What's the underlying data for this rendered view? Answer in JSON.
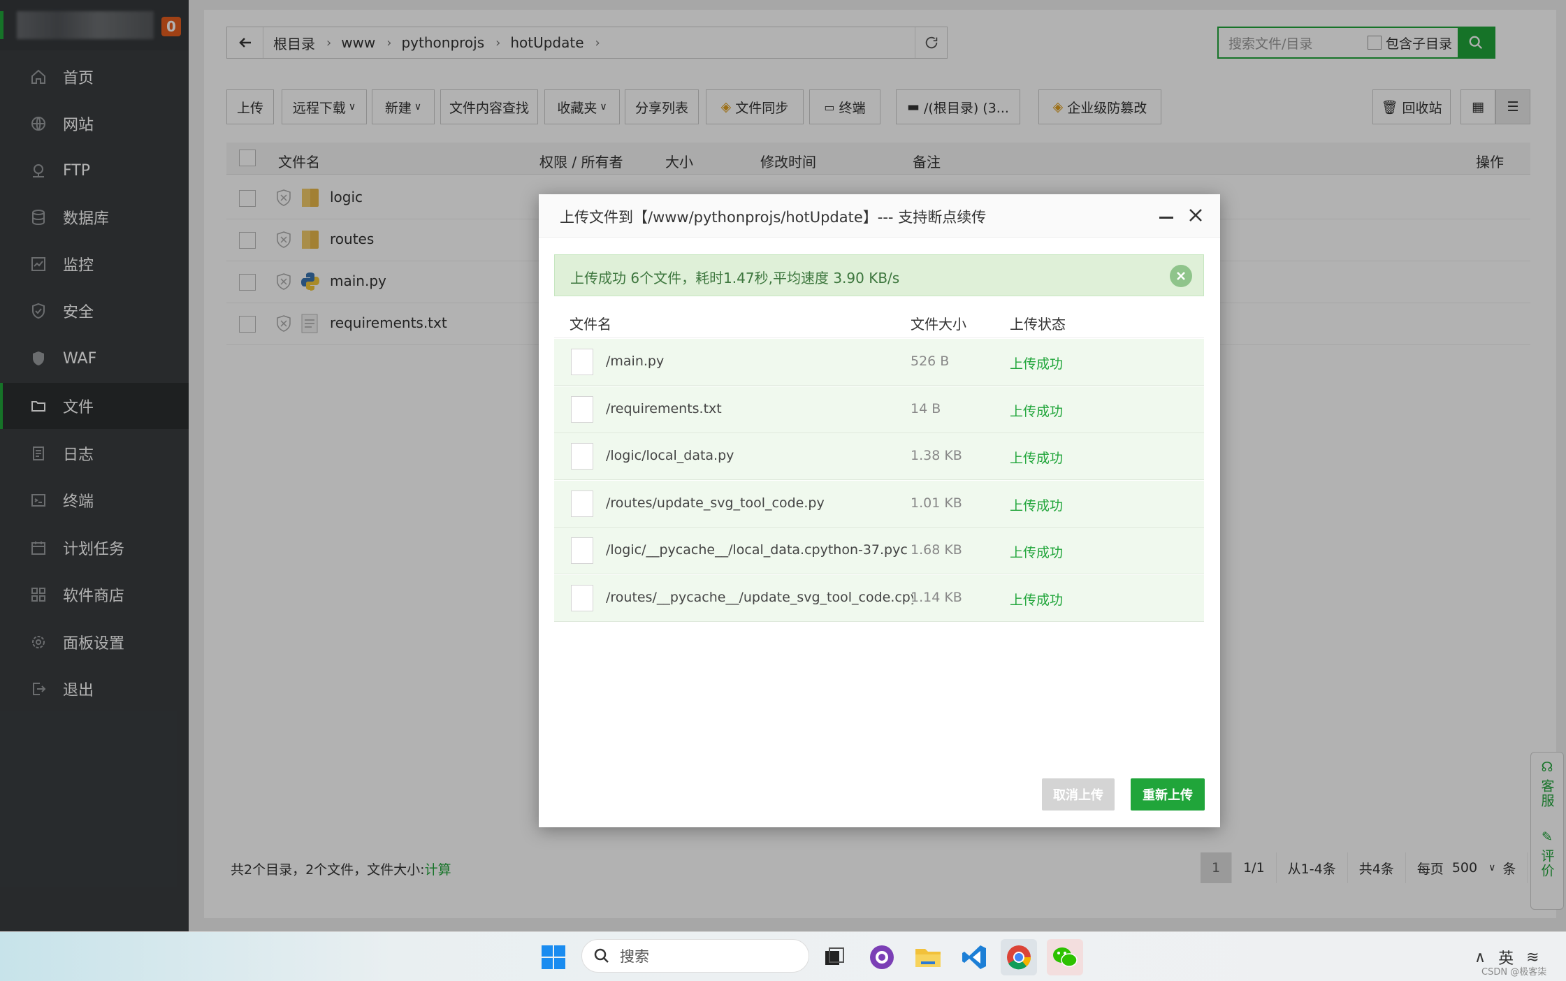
{
  "sidebar": {
    "badge": "0",
    "items": [
      {
        "label": "首页",
        "icon": "home-icon"
      },
      {
        "label": "网站",
        "icon": "globe-icon"
      },
      {
        "label": "FTP",
        "icon": "ftp-icon"
      },
      {
        "label": "数据库",
        "icon": "database-icon"
      },
      {
        "label": "监控",
        "icon": "monitor-icon"
      },
      {
        "label": "安全",
        "icon": "shield-icon"
      },
      {
        "label": "WAF",
        "icon": "waf-shield-icon"
      },
      {
        "label": "文件",
        "icon": "folder-icon",
        "active": true
      },
      {
        "label": "日志",
        "icon": "log-icon"
      },
      {
        "label": "终端",
        "icon": "terminal-icon"
      },
      {
        "label": "计划任务",
        "icon": "calendar-icon"
      },
      {
        "label": "软件商店",
        "icon": "apps-icon"
      },
      {
        "label": "面板设置",
        "icon": "gear-icon"
      },
      {
        "label": "退出",
        "icon": "logout-icon"
      }
    ]
  },
  "breadcrumb": [
    "根目录",
    "www",
    "pythonprojs",
    "hotUpdate"
  ],
  "search": {
    "placeholder": "搜索文件/目录",
    "include_sub_label": "包含子目录"
  },
  "toolbar": {
    "upload": "上传",
    "remote_download": "远程下载",
    "new": "新建",
    "content_search": "文件内容查找",
    "favorites": "收藏夹",
    "share_list": "分享列表",
    "file_sync": "文件同步",
    "terminal": "终端",
    "disk": "/(根目录) (3...",
    "tamper": "企业级防篡改",
    "recycle": "回收站"
  },
  "table": {
    "headers": {
      "name": "文件名",
      "perm": "权限 / 所有者",
      "size": "大小",
      "mtime": "修改时间",
      "note": "备注",
      "ops": "操作"
    },
    "rows": [
      {
        "name": "logic",
        "type": "folder"
      },
      {
        "name": "routes",
        "type": "folder"
      },
      {
        "name": "main.py",
        "type": "python"
      },
      {
        "name": "requirements.txt",
        "type": "text"
      }
    ]
  },
  "footer": {
    "summary": "共2个目录，2个文件，文件大小:",
    "calc": "计算"
  },
  "pager": {
    "current": "1",
    "pages": "1/1",
    "range": "从1-4条",
    "total": "共4条",
    "per_page_label": "每页",
    "per_page": "500",
    "unit": "条"
  },
  "float_panel": {
    "service": "客服",
    "review": "评价"
  },
  "modal": {
    "title": "上传文件到【/www/pythonprojs/hotUpdate】--- 支持断点续传",
    "banner": "上传成功 6个文件，耗时1.47秒,平均速度 3.90 KB/s",
    "headers": {
      "name": "文件名",
      "size": "文件大小",
      "status": "上传状态"
    },
    "files": [
      {
        "path": "/main.py",
        "size": "526 B",
        "status": "上传成功"
      },
      {
        "path": "/requirements.txt",
        "size": "14 B",
        "status": "上传成功"
      },
      {
        "path": "/logic/local_data.py",
        "size": "1.38 KB",
        "status": "上传成功"
      },
      {
        "path": "/routes/update_svg_tool_code.py",
        "size": "1.01 KB",
        "status": "上传成功"
      },
      {
        "path": "/logic/__pycache__/local_data.cpython-37.pyc",
        "size": "1.68 KB",
        "status": "上传成功"
      },
      {
        "path": "/routes/__pycache__/update_svg_tool_code.cpyth...",
        "size": "1.14 KB",
        "status": "上传成功"
      }
    ],
    "cancel": "取消上传",
    "reupload": "重新上传"
  },
  "taskbar": {
    "search": "搜索",
    "ime": "英",
    "watermark": "CSDN @极客柒"
  }
}
